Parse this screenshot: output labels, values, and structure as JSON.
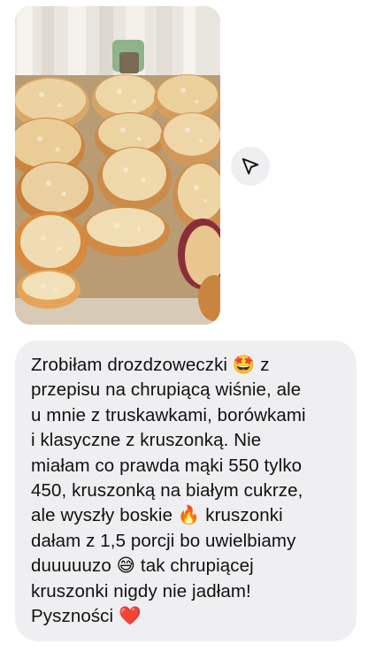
{
  "message": {
    "photo": {
      "alt": ""
    },
    "share_icon": "paper-plane-icon",
    "lines": [
      "Zrobiłam drozdzoweczki 🤩 z",
      "przepisu na chrupiącą wiśnie, ale",
      "u mnie z truskawkami, borówkami",
      "i klasyczne z kruszonką. Nie",
      "miałam co prawda mąki 550 tylko",
      "450, kruszonką na białym cukrze,",
      "ale wyszły boskie 🔥 kruszonki",
      "dałam z 1,5 porcji bo uwielbiamy",
      "duuuuuzo 😅 tak chrupiącej",
      "kruszonki nigdy nie jadłam!",
      "Pyszności ❤️"
    ]
  },
  "colors": {
    "bubble_bg": "#efeff1",
    "text": "#111111",
    "page_bg": "#ffffff"
  }
}
